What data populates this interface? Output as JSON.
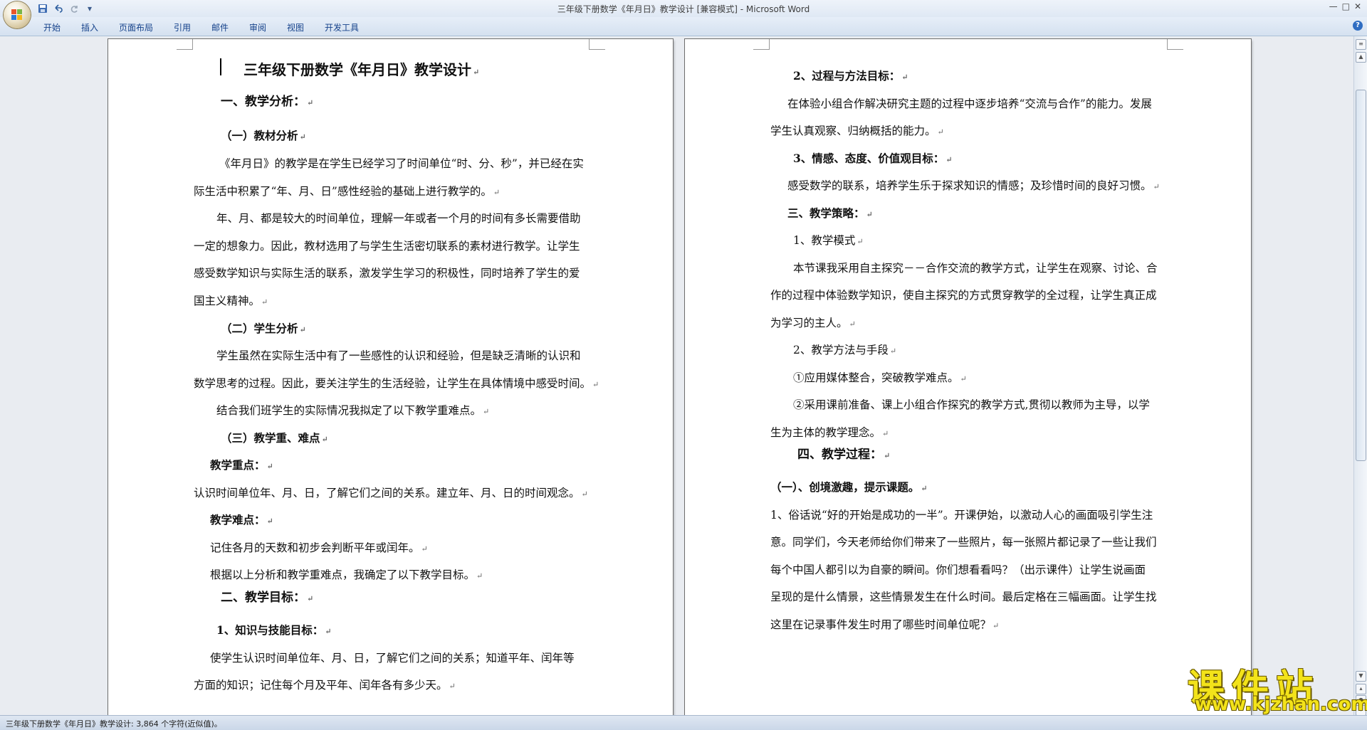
{
  "window": {
    "title": "三年级下册数学《年月日》教学设计 [兼容模式] - Microsoft Word",
    "controls": [
      "—",
      "□",
      "✕"
    ]
  },
  "quick_access": {
    "save_icon": "save-icon",
    "undo_icon": "undo-icon",
    "redo_icon": "redo-icon",
    "customize": "▾"
  },
  "ribbon": {
    "tabs": [
      "开始",
      "插入",
      "页面布局",
      "引用",
      "邮件",
      "审阅",
      "视图",
      "开发工具"
    ],
    "help": "?"
  },
  "left_page": {
    "title": "三年级下册数学《年月日》教学设计",
    "lines": [
      "一、教学分析：",
      "（一）教材分析",
      "《年月日》的教学是在学生已经学习了时间单位“时、分、秒”，并已经在实",
      "际生活中积累了“年、月、日”感性经验的基础上进行教学的。",
      "年、月、都是较大的时间单位，理解一年或者一个月的时间有多长需要借助",
      "一定的想象力。因此，教材选用了与学生生活密切联系的素材进行教学。让学生",
      "感受数学知识与实际生活的联系，激发学生学习的积极性，同时培养了学生的爱",
      "国主义精神。",
      "（二）学生分析",
      "学生虽然在实际生活中有了一些感性的认识和经验，但是缺乏清晰的认识和",
      "数学思考的过程。因此，要关注学生的生活经验，让学生在具体情境中感受时间。",
      "结合我们班学生的实际情况我拟定了以下教学重难点。",
      "（三）教学重、难点",
      "教学重点：",
      "认识时间单位年、月、日，了解它们之间的关系。建立年、月、日的时间观念。",
      "教学难点：",
      "记住各月的天数和初步会判断平年或闰年。",
      "根据以上分析和教学重难点，我确定了以下教学目标。",
      "二、教学目标：",
      "1、知识与技能目标：",
      "使学生认识时间单位年、月、日，了解它们之间的关系；知道平年、闰年等",
      "方面的知识；记住每个月及平年、闰年各有多少天。"
    ]
  },
  "right_page": {
    "lines": [
      "2、过程与方法目标：",
      "在体验小组合作解决研究主题的过程中逐步培养“交流与合作”的能力。发展",
      "学生认真观察、归纳概括的能力。",
      "3、情感、态度、价值观目标：",
      "感受数学的联系，培养学生乐于探求知识的情感；及珍惜时间的良好习惯。",
      "三、教学策略：",
      "1、教学模式",
      "本节课我采用自主探究－－合作交流的教学方式，让学生在观察、讨论、合",
      "作的过程中体验数学知识，使自主探究的方式贯穿教学的全过程，让学生真正成",
      "为学习的主人。",
      "2、教学方法与手段",
      "①应用媒体整合，突破教学难点。",
      "②采用课前准备、课上小组合作探究的教学方式,贯彻以教师为主导，以学",
      "生为主体的教学理念。",
      "四、教学过程：",
      "（一）、创境激趣，提示课题。",
      "1、俗话说“好的开始是成功的一半”。开课伊始，以激动人心的画面吸引学生注",
      "意。同学们，今天老师给你们带来了一些照片，每一张照片都记录了一些让我们",
      "每个中国人都引以为自豪的瞬间。你们想看看吗？（出示课件）让学生说画面",
      "呈现的是什么情景，这些情景发生在什么时间。最后定格在三幅画面。让学生找",
      "这里在记录事件发生时用了哪些时间单位呢？"
    ]
  },
  "paragraph_mark": "↵",
  "status": {
    "text": "三年级下册数学《年月日》教学设计: 3,864 个字符(近似值)。"
  },
  "watermark": {
    "cn": "课件站",
    "url": "www.kjzhan.com",
    "color": "#f3e31a"
  }
}
